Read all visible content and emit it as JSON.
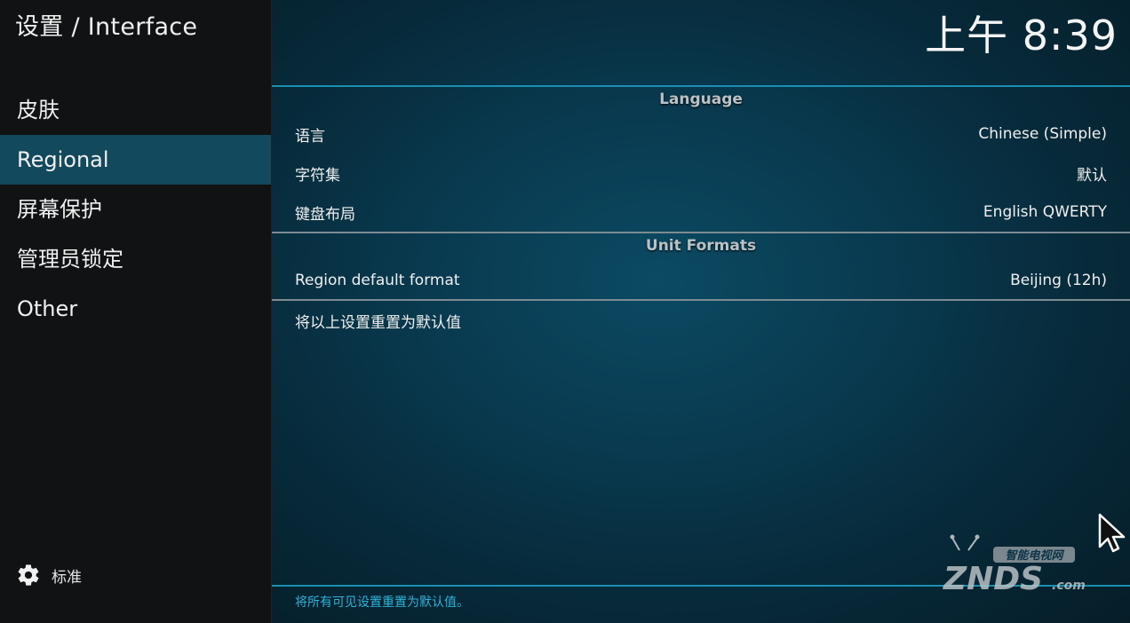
{
  "header": {
    "title": "设置 / Interface",
    "clock": "上午 8:39"
  },
  "sidebar": {
    "items": [
      {
        "label": "皮肤"
      },
      {
        "label": "Regional"
      },
      {
        "label": "屏幕保护"
      },
      {
        "label": "管理员锁定"
      },
      {
        "label": "Other"
      }
    ],
    "selected_index": 1,
    "footer": {
      "icon": "gear-icon",
      "label": "标准"
    }
  },
  "main": {
    "sections": [
      {
        "header": "Language",
        "rows": [
          {
            "label": "语言",
            "value": "Chinese (Simple)"
          },
          {
            "label": "字符集",
            "value": "默认"
          },
          {
            "label": "键盘布局",
            "value": "English QWERTY"
          }
        ]
      },
      {
        "header": "Unit Formats",
        "rows": [
          {
            "label": "Region default format",
            "value": "Beijing (12h)"
          }
        ]
      }
    ],
    "reset_label": "将以上设置重置为默认值",
    "hint": "将所有可见设置重置为默认值。"
  },
  "watermark": {
    "brand": "ZNDS",
    "suffix": ".com",
    "tagline": "智能电视网"
  },
  "colors": {
    "selected": "#12495c",
    "accent_rule": "#1a8fb0",
    "hint_text": "#2fb3d8"
  }
}
